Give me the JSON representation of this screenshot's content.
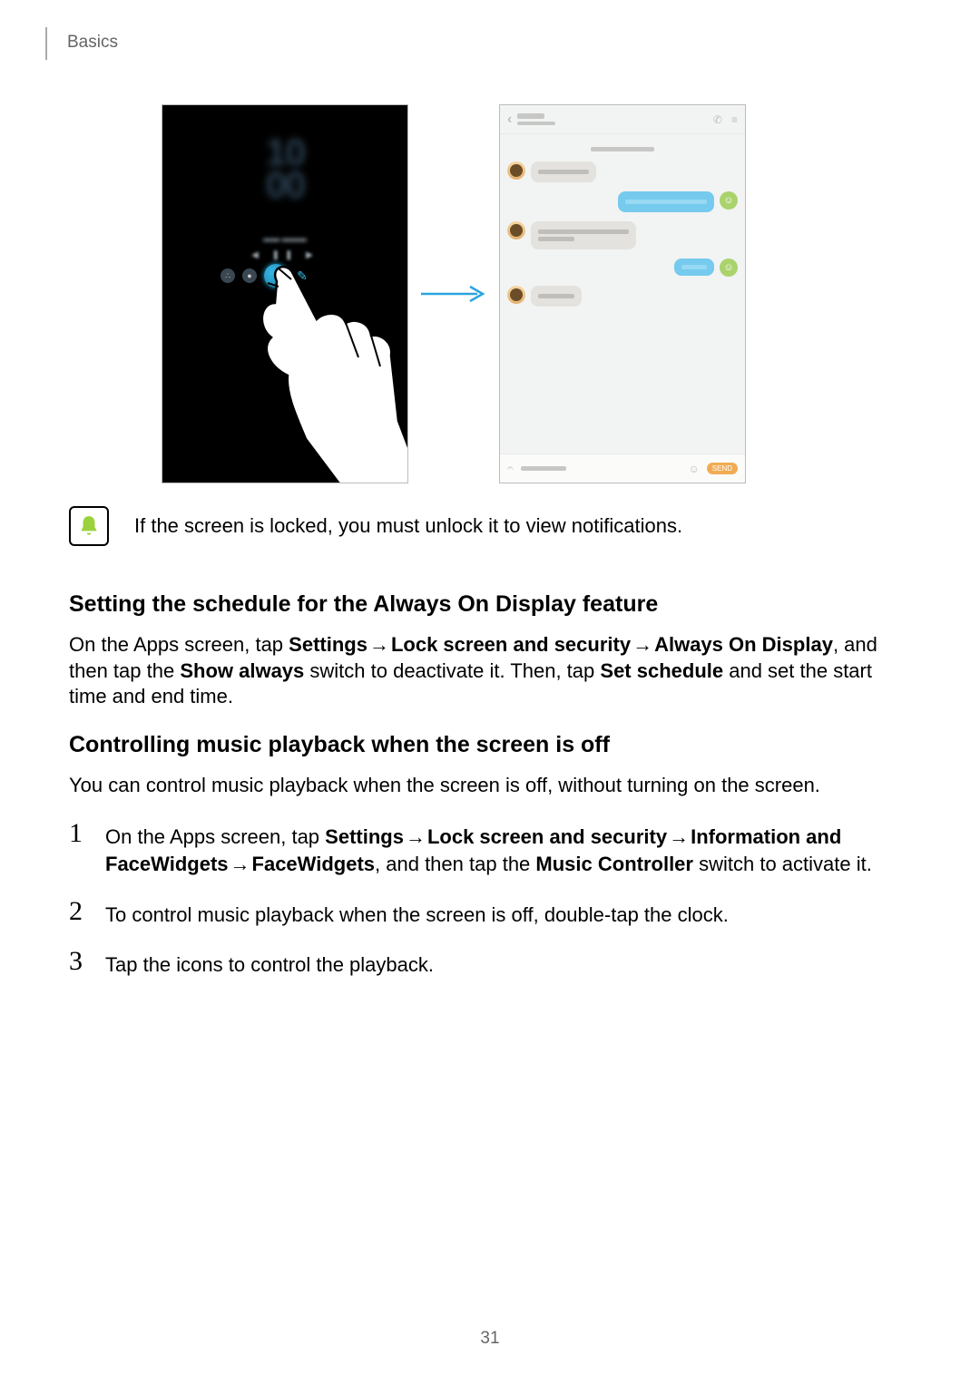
{
  "header": {
    "section": "Basics"
  },
  "figure": {
    "clock_line1": "10",
    "clock_line2": "00",
    "chat": {
      "back_glyph": "‹",
      "phone_glyph": "✆",
      "menu_glyph": "≡",
      "attach_glyph": "𝄐",
      "emoji_glyph": "☺",
      "send_label": "SEND"
    }
  },
  "note": {
    "text": "If the screen is locked, you must unlock it to view notifications."
  },
  "section1": {
    "heading": "Setting the schedule for the Always On Display feature",
    "para": {
      "pre": "On the Apps screen, tap ",
      "b1": "Settings",
      "a1": " → ",
      "b2": "Lock screen and security",
      "a2": " → ",
      "b3": "Always On Display",
      "mid": ", and then tap the ",
      "b4": "Show always",
      "mid2": " switch to deactivate it. Then, tap ",
      "b5": "Set schedule",
      "post": " and set the start time and end time."
    }
  },
  "section2": {
    "heading": "Controlling music playback when the screen is off",
    "intro": "You can control music playback when the screen is off, without turning on the screen.",
    "steps": [
      {
        "num": "1",
        "pre": "On the Apps screen, tap ",
        "b1": "Settings",
        "a1": " → ",
        "b2": "Lock screen and security",
        "a2": " → ",
        "b3": "Information and FaceWidgets",
        "a3": " → ",
        "b4": "FaceWidgets",
        "mid": ", and then tap the ",
        "b5": "Music Controller",
        "post": " switch to activate it."
      },
      {
        "num": "2",
        "text": "To control music playback when the screen is off, double-tap the clock."
      },
      {
        "num": "3",
        "text": "Tap the icons to control the playback."
      }
    ]
  },
  "page_number": "31"
}
